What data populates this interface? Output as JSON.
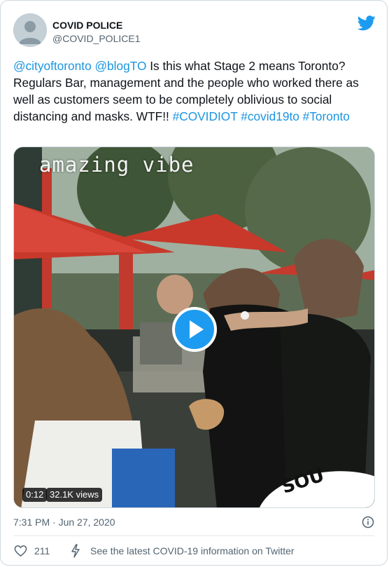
{
  "tweet": {
    "display_name": "COVID POLICE",
    "handle": "@COVID_POLICE1",
    "text_parts": [
      {
        "text": "@cityoftoronto",
        "link": true
      },
      {
        "text": " ",
        "link": false
      },
      {
        "text": "@blogTO",
        "link": true
      },
      {
        "text": " Is this what Stage 2 means Toronto? Regulars Bar, management and the people who worked there as well as customers seem to be completely oblivious to social distancing and masks. WTF!! ",
        "link": false
      },
      {
        "text": "#COVIDIOT",
        "link": true
      },
      {
        "text": " ",
        "link": false
      },
      {
        "text": "#covid19to",
        "link": true
      },
      {
        "text": " ",
        "link": false
      },
      {
        "text": "#Toronto",
        "link": true
      }
    ],
    "video": {
      "caption": "amazing vibe",
      "duration": "0:12",
      "views": "32.1K views",
      "sign_text": "SOU"
    },
    "timestamp": "7:31 PM · Jun 27, 2020",
    "likes": "211",
    "covid_notice": "See the latest COVID-19 information on Twitter"
  },
  "colors": {
    "accent": "#1d9bf0",
    "link": "#1b95e0",
    "muted": "#536471",
    "heart": "#536471"
  },
  "icons": [
    "twitter-bird-icon",
    "play-icon",
    "info-icon",
    "heart-icon",
    "lightning-icon"
  ]
}
